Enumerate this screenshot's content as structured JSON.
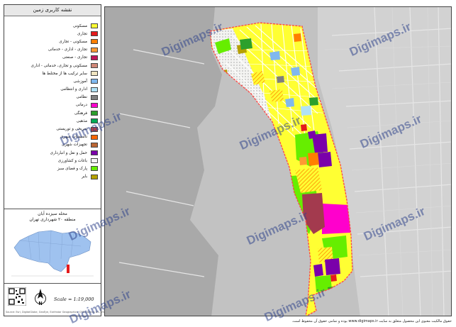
{
  "legend": {
    "title": "نقشه کاربری زمین",
    "items": [
      {
        "label": "مسکونی",
        "color": "#ffff33"
      },
      {
        "label": "تجاری",
        "color": "#e41a1c"
      },
      {
        "label": "مسکونی - تجاری",
        "color": "#ff7f00"
      },
      {
        "label": "تجاری - اداری - خدماتی",
        "color": "#ff9933"
      },
      {
        "label": "تجاری - صنعتی",
        "color": "#c0145a"
      },
      {
        "label": "مسکونی و تجاری، خدماتی - اداری",
        "color": "#d08878"
      },
      {
        "label": "سایر ترکیب ها از مختلط ها",
        "color": "#f1e5c0"
      },
      {
        "label": "آموزشی",
        "color": "#80b8ee"
      },
      {
        "label": "اداری و انتظامی",
        "color": "#b0e2f7"
      },
      {
        "label": "نظامی",
        "color": "#7f7f7f"
      },
      {
        "label": "درمانی",
        "color": "#ff00cc"
      },
      {
        "label": "فرهنگی",
        "color": "#2ca02c"
      },
      {
        "label": "مذهبی",
        "color": "#00aa55"
      },
      {
        "label": "تفریحی و توریستی",
        "color": "#c43e3e"
      },
      {
        "label": "تاسیسات شهری",
        "color": "#ff6600"
      },
      {
        "label": "تجهیزات شهری",
        "color": "#bb6633"
      },
      {
        "label": "حمل و نقل و انبارداری",
        "color": "#7a00aa"
      },
      {
        "label": "باغات و کشاورزی",
        "color": "#f6f6f6"
      },
      {
        "label": "پارک و فضای سبز",
        "color": "#66ee00"
      },
      {
        "label": "بایر",
        "color": "#b5a000"
      }
    ]
  },
  "region": {
    "title": "محله سیزده آبان",
    "subtitle": "منطقه ۲۰ شهرداری تهران"
  },
  "scale": "Scale = 1:19,000",
  "north_label": "N",
  "credit": "Source: Esri, DigitalGlobe, GeoEye, Earthstar Geographics, CNES/Airbus DS, USDA, USGS, AeroGRID, IGN, and the GIS User Community",
  "copyright": "حقوق مالکیت معنوی این محصول متعلق به سایت www.digimaps.ir بوده و تمامی حقوق آن محفوظ است.",
  "watermark": "Digimaps.ir",
  "colors": {
    "map_background": "#c2c2c2",
    "boundary": "#ff4444",
    "inset_fill": "#9fc2ef",
    "inset_highlight": "#e41a1c"
  }
}
